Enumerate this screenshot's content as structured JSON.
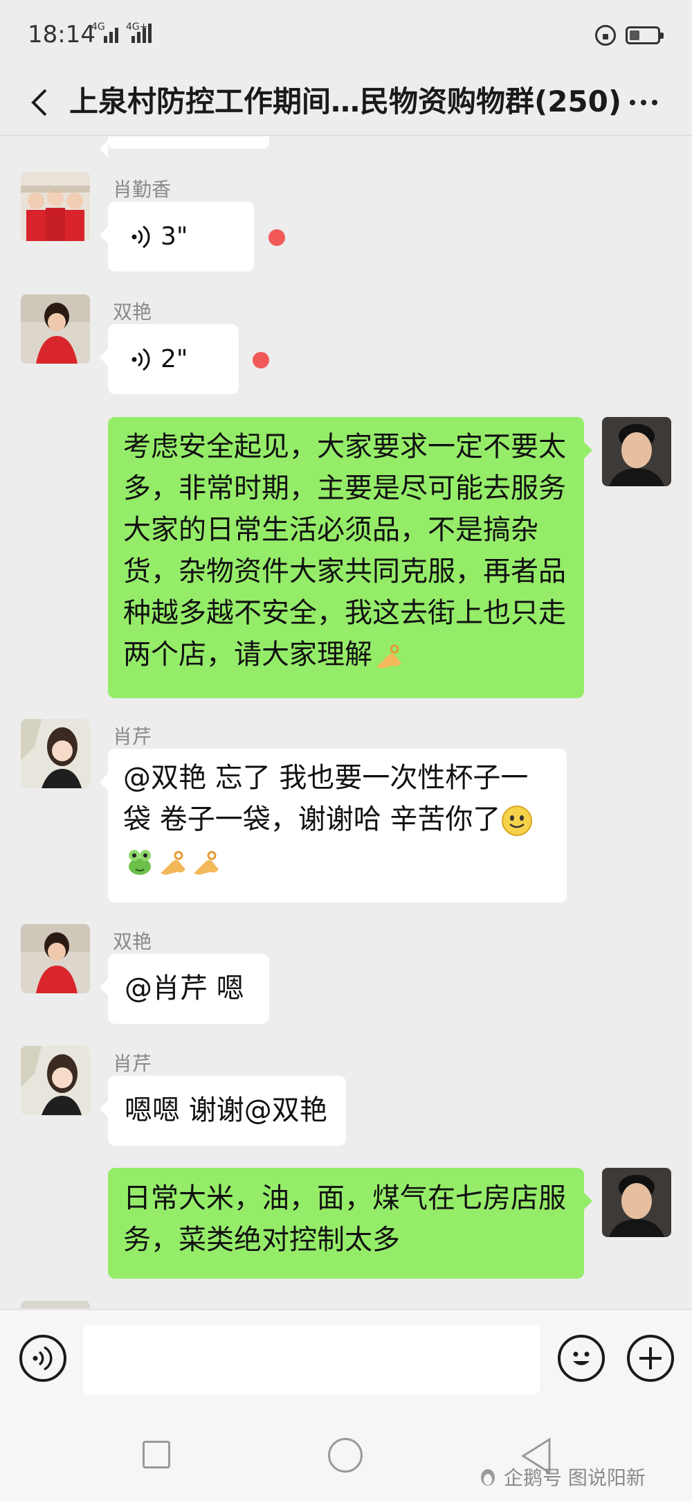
{
  "status_bar": {
    "time": "18:14",
    "network_1": "4G",
    "network_2": "4G+"
  },
  "header": {
    "title": "上泉村防控工作期间…民物资购物群(250)"
  },
  "messages": [
    {
      "sender": "肖勤香",
      "side": "left",
      "type": "voice",
      "duration": "3\"",
      "unread": true
    },
    {
      "sender": "双艳",
      "side": "left",
      "type": "voice",
      "duration": "2\"",
      "unread": true
    },
    {
      "sender": "",
      "side": "right",
      "type": "text",
      "text": "考虑安全起见，大家要求一定不要太\n多，非常时期，主要是尽可能去服务\n大家的日常生活必须品，不是搞杂\n货，杂物资件大家共同克服，再者品\n种越多越不安全，我这去街上也只走\n两个店，请大家理解",
      "emoji": "ok-hand-emoji"
    },
    {
      "sender": "肖芹",
      "side": "left",
      "type": "text",
      "text": "@双艳  忘了 我也要一次性杯子一\n袋 卷子一袋，谢谢哈 辛苦你了",
      "emojis": [
        "smile-emoji",
        "frog-emoji",
        "ok-hand-emoji",
        "ok-hand-emoji"
      ]
    },
    {
      "sender": "双艳",
      "side": "left",
      "type": "text",
      "text": "@肖芹   嗯"
    },
    {
      "sender": "肖芹",
      "side": "left",
      "type": "text",
      "text": "嗯嗯 谢谢@双艳"
    },
    {
      "sender": "",
      "side": "right",
      "type": "text",
      "text": "日常大米，油，面，煤气在七房店服\n务，菜类绝对控制太多"
    }
  ],
  "input": {
    "placeholder": ""
  },
  "watermark": {
    "text": "企鹅号 图说阳新"
  },
  "colors": {
    "background": "#ededed",
    "green_bubble": "#95ec69",
    "white_bubble": "#ffffff",
    "unread_dot": "#f25a5a",
    "sender_name": "#8a8a8a"
  }
}
